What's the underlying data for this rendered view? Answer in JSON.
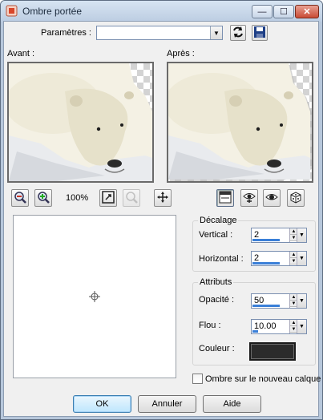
{
  "window": {
    "title": "Ombre portée",
    "controls": {
      "minimize": "—",
      "maximize": "☐",
      "close": "✕"
    }
  },
  "presets": {
    "label": "Paramètres :",
    "value": ""
  },
  "previews": {
    "before_label": "Avant :",
    "after_label": "Après :"
  },
  "zoom": {
    "level": "100%"
  },
  "offset_group": {
    "title": "Décalage",
    "vertical_label": "Vertical :",
    "vertical_value": "2",
    "horizontal_label": "Horizontal :",
    "horizontal_value": "2"
  },
  "attributes_group": {
    "title": "Attributs",
    "opacity_label": "Opacité :",
    "opacity_value": "50",
    "blur_label": "Flou :",
    "blur_value": "10.00",
    "color_label": "Couleur :",
    "color_value": "#2b2b2b"
  },
  "new_layer": {
    "label": "Ombre sur le nouveau calque",
    "checked": false
  },
  "buttons": {
    "ok": "OK",
    "cancel": "Annuler",
    "help": "Aide"
  },
  "colors": {
    "accent": "#3a7fd8",
    "titlebar": "#c6d6ea"
  }
}
